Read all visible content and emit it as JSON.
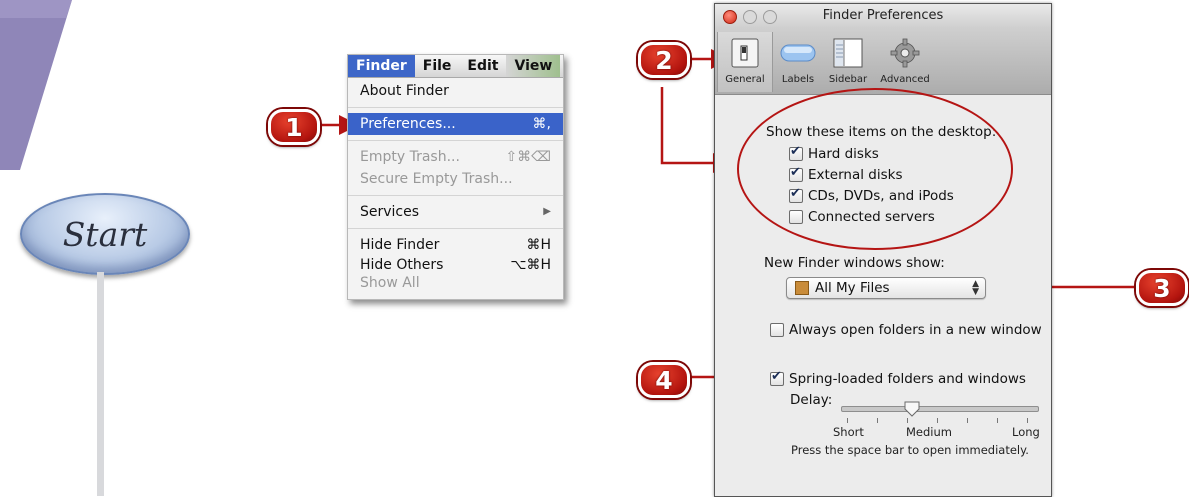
{
  "start_label": "Start",
  "markers": {
    "m1": "1",
    "m2": "2",
    "m3": "3",
    "m4": "4"
  },
  "menu": {
    "bar": [
      "Finder",
      "File",
      "Edit",
      "View"
    ],
    "about": "About Finder",
    "preferences": {
      "label": "Preferences...",
      "shortcut": "⌘,"
    },
    "empty_trash": {
      "label": "Empty Trash...",
      "shortcut": "⇧⌘⌫"
    },
    "secure_empty_trash": "Secure Empty Trash...",
    "services": {
      "label": "Services",
      "arrow": "▶"
    },
    "hide_finder": {
      "label": "Hide Finder",
      "shortcut": "⌘H"
    },
    "hide_others": {
      "label": "Hide Others",
      "shortcut": "⌥⌘H"
    },
    "show_all": "Show All"
  },
  "prefs": {
    "title": "Finder Preferences",
    "toolbar": [
      "General",
      "Labels",
      "Sidebar",
      "Advanced"
    ],
    "desktop_heading": "Show these items on the desktop:",
    "desktop_items": [
      {
        "label": "Hard disks",
        "checked": true
      },
      {
        "label": "External disks",
        "checked": true
      },
      {
        "label": "CDs, DVDs, and iPods",
        "checked": true
      },
      {
        "label": "Connected servers",
        "checked": false
      }
    ],
    "new_window_label": "New Finder windows show:",
    "new_window_value": "All My Files",
    "always_open_label": "Always open folders in a new window",
    "always_open_checked": false,
    "spring_label": "Spring-loaded folders and windows",
    "spring_checked": true,
    "delay_label": "Delay:",
    "delay_short": "Short",
    "delay_medium": "Medium",
    "delay_long": "Long",
    "delay_level": 0.35,
    "space_hint": "Press the space bar to open immediately."
  },
  "colors": {
    "accent_red": "#b51514",
    "menu_highlight": "#3a63c9",
    "corner_tab": "#8f86b8"
  }
}
